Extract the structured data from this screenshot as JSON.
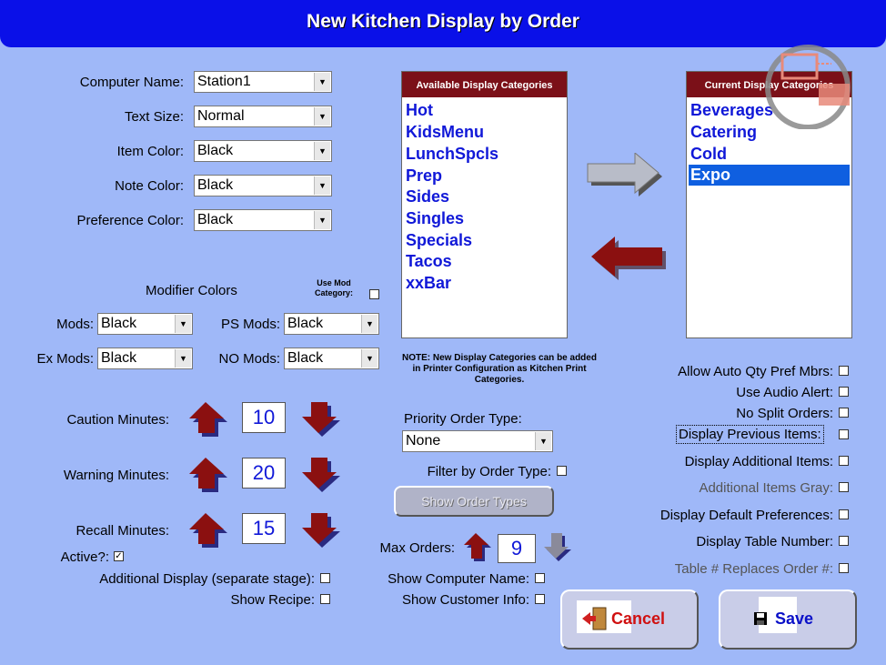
{
  "window": {
    "title": "New Kitchen Display by Order"
  },
  "left_fields": [
    {
      "label": "Computer Name:",
      "value": "Station1"
    },
    {
      "label": "Text Size:",
      "value": "Normal"
    },
    {
      "label": "Item Color:",
      "value": "Black"
    },
    {
      "label": "Note Color:",
      "value": "Black"
    },
    {
      "label": "Preference Color:",
      "value": "Black"
    }
  ],
  "modifier_colors": {
    "heading": "Modifier Colors",
    "use_mod_category_label": "Use Mod Category:",
    "mods": {
      "label": "Mods:",
      "value": "Black"
    },
    "ps_mods": {
      "label": "PS Mods:",
      "value": "Black"
    },
    "ex_mods": {
      "label": "Ex Mods:",
      "value": "Black"
    },
    "no_mods": {
      "label": "NO Mods:",
      "value": "Black"
    }
  },
  "available_categories": {
    "header": "Available Display Categories",
    "items": [
      "Hot",
      "KidsMenu",
      "LunchSpcls",
      "Prep",
      "Sides",
      "Singles",
      "Specials",
      "Tacos",
      "xxBar"
    ]
  },
  "current_categories": {
    "header": "Current Display Categories",
    "items": [
      "Beverages",
      "Catering",
      "Cold",
      "Expo"
    ],
    "selected": "Expo"
  },
  "note": "NOTE: New Display Categories can be added in Printer Configuration as Kitchen Print Categories.",
  "minutes": {
    "caution": {
      "label": "Caution Minutes:",
      "value": "10"
    },
    "warning": {
      "label": "Warning Minutes:",
      "value": "20"
    },
    "recall": {
      "label": "Recall Minutes:",
      "value": "15"
    }
  },
  "active": {
    "label": "Active?:",
    "checked": true
  },
  "additional_display_label": "Additional Display (separate stage):",
  "show_recipe_label": "Show Recipe:",
  "priority_order": {
    "label": "Priority Order Type:",
    "value": "None"
  },
  "filter_by_order_type_label": "Filter by Order Type:",
  "show_order_types_button": "Show Order Types",
  "max_orders": {
    "label": "Max Orders:",
    "value": "9"
  },
  "show_computer_name_label": "Show Computer Name:",
  "show_customer_info_label": "Show Customer Info:",
  "right_options": [
    "Allow Auto Qty Pref Mbrs:",
    "Use Audio Alert:",
    "No Split Orders:",
    "Display Previous Items:",
    "Display Additional Items:",
    "Additional Items Gray:",
    "Display Default Preferences:",
    "Display Table Number:",
    "Table # Replaces Order #:"
  ],
  "buttons": {
    "cancel": "Cancel",
    "save": "Save"
  },
  "colors": {
    "background": "#9fb8f8",
    "titlebar": "#0a10e8",
    "list_text": "#1018d8",
    "arrow_red": "#8b1010",
    "list_header": "#7b1018"
  }
}
